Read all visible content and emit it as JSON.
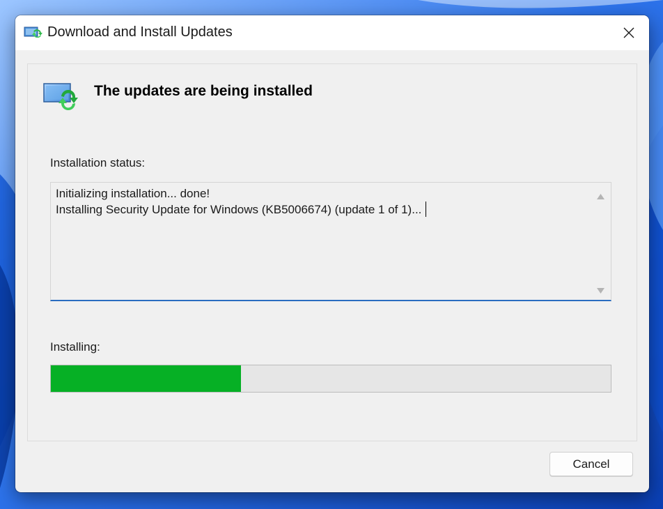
{
  "window": {
    "title": "Download and Install Updates",
    "title_icon": "windows-update-icon",
    "close_icon": "close-icon"
  },
  "main": {
    "heading": "The updates are being installed",
    "heading_icon": "computer-update-icon",
    "status_label": "Installation status:",
    "status_lines": [
      "Initializing installation... done!",
      "Installing Security Update for Windows (KB5006674) (update 1 of 1)..."
    ],
    "progress_label": "Installing:",
    "progress_fraction": 0.34,
    "progress_color": "#06b025"
  },
  "footer": {
    "cancel_label": "Cancel"
  }
}
